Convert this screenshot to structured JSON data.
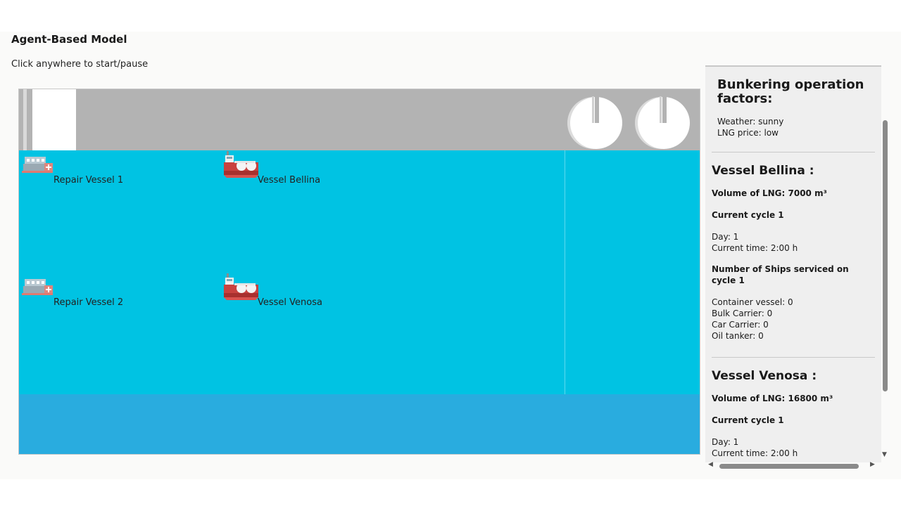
{
  "header": {
    "title": "Agent-Based Model",
    "subtitle": "Click anywhere to start/pause"
  },
  "simulation": {
    "ships": [
      {
        "label": "Repair Vessel 1",
        "type": "repair",
        "icon": "repair-vessel-icon"
      },
      {
        "label": "Vessel Bellina",
        "type": "bunker",
        "icon": "lng-bunker-vessel-icon"
      },
      {
        "label": "Repair Vessel 2",
        "type": "repair",
        "icon": "repair-vessel-icon"
      },
      {
        "label": "Vessel Venosa",
        "type": "bunker",
        "icon": "lng-bunker-vessel-icon"
      }
    ],
    "colors": {
      "water": "#00c3e3",
      "deep_water": "#29acdf",
      "dock": "#b3b3b3"
    }
  },
  "panel": {
    "factors": {
      "title": "Bunkering operation factors:",
      "weather": "Weather: sunny",
      "lng_price": "LNG price: low"
    },
    "vessels": [
      {
        "title": "Vessel Bellina :",
        "volume": "Volume of LNG: 7000 m³",
        "cycle": "Current cycle 1",
        "day": "Day: 1",
        "time": "Current time: 2:00 h",
        "serviced_heading": "Number of Ships serviced on cycle 1",
        "container": "Container vessel: 0",
        "bulk": "Bulk Carrier: 0",
        "car": "Car Carrier: 0",
        "oil": "Oil tanker: 0"
      },
      {
        "title": "Vessel Venosa :",
        "volume": "Volume of LNG: 16800 m³",
        "cycle": "Current cycle 1",
        "day": "Day: 1",
        "time": "Current time: 2:00 h"
      }
    ]
  }
}
